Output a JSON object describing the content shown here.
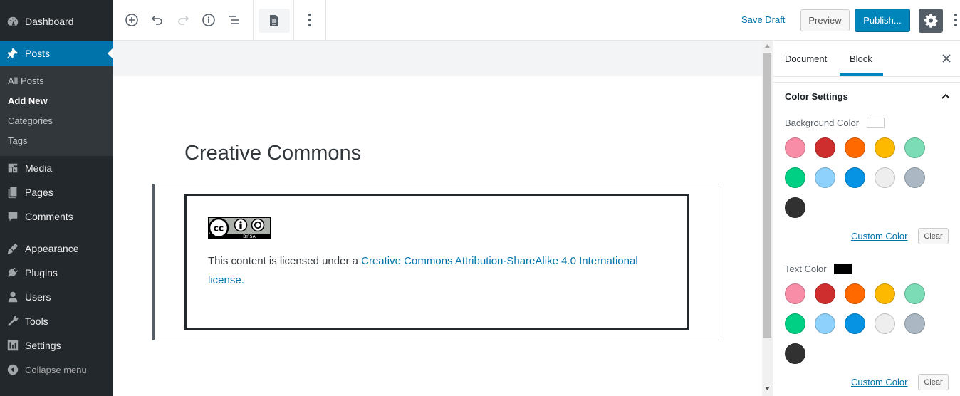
{
  "admin_menu": {
    "items": [
      {
        "label": "Dashboard",
        "icon": "dashboard-icon"
      },
      {
        "label": "Posts",
        "icon": "pin-icon"
      },
      {
        "label": "Media",
        "icon": "media-icon"
      },
      {
        "label": "Pages",
        "icon": "pages-icon"
      },
      {
        "label": "Comments",
        "icon": "comments-icon"
      },
      {
        "label": "Appearance",
        "icon": "brush-icon"
      },
      {
        "label": "Plugins",
        "icon": "plug-icon"
      },
      {
        "label": "Users",
        "icon": "users-icon"
      },
      {
        "label": "Tools",
        "icon": "wrench-icon"
      },
      {
        "label": "Settings",
        "icon": "settings-sliders-icon"
      }
    ],
    "posts_submenu": [
      "All Posts",
      "Add New",
      "Categories",
      "Tags"
    ],
    "collapse_label": "Collapse menu"
  },
  "toolbar": {
    "save_draft": "Save Draft",
    "preview": "Preview",
    "publish": "Publish..."
  },
  "editor": {
    "title": "Creative Commons",
    "license_prefix": "This content is licensed under a ",
    "license_link": "Creative Commons Attribution-ShareAlike 4.0 International license.",
    "badge_text": "BY SA"
  },
  "sidebar": {
    "tabs": [
      "Document",
      "Block"
    ],
    "active_tab": "Block",
    "panel_title": "Color Settings",
    "background": {
      "label": "Background Color",
      "current_color": "#ffffff",
      "custom_label": "Custom Color",
      "clear_label": "Clear"
    },
    "text": {
      "label": "Text Color",
      "current_color": "#000000",
      "custom_label": "Custom Color",
      "clear_label": "Clear"
    },
    "palette": [
      "#f78da7",
      "#cf2e2e",
      "#ff6900",
      "#fcb900",
      "#7bdcb5",
      "#00d084",
      "#8ed1fc",
      "#0693e3",
      "#eeeeee",
      "#abb8c3",
      "#313131"
    ]
  },
  "colors": {
    "admin_bg": "#23282d",
    "accent": "#0073aa",
    "publish": "#0085ba"
  }
}
